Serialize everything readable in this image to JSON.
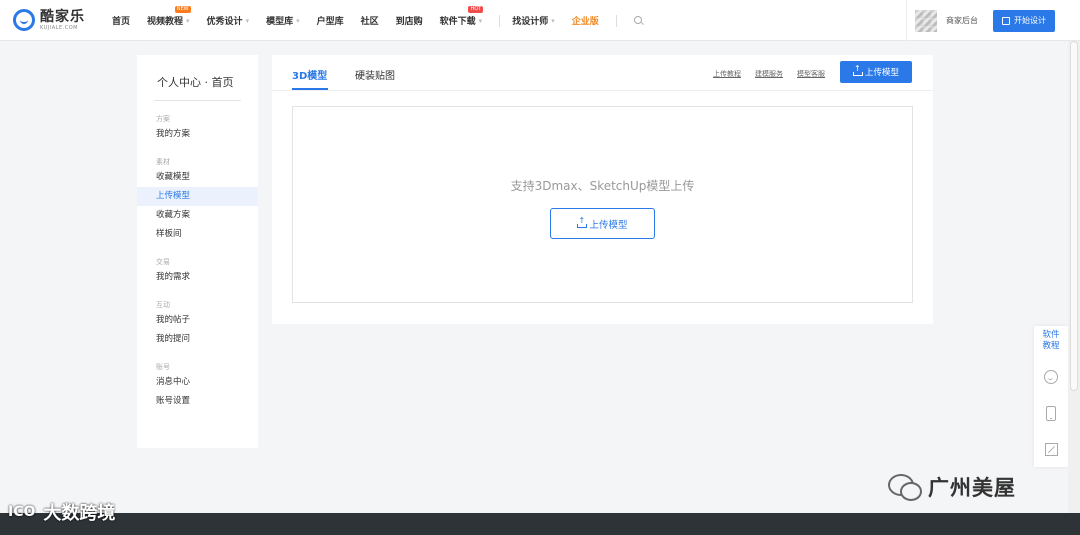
{
  "header": {
    "logo_cn": "酷家乐",
    "logo_en": "KUJIALE.COM",
    "nav": [
      {
        "label": "首页",
        "caret": false,
        "badge": ""
      },
      {
        "label": "视频教程",
        "caret": true,
        "badge": "NEW"
      },
      {
        "label": "优秀设计",
        "caret": true,
        "badge": ""
      },
      {
        "label": "模型库",
        "caret": true,
        "badge": ""
      },
      {
        "label": "户型库",
        "caret": false,
        "badge": ""
      },
      {
        "label": "社区",
        "caret": false,
        "badge": ""
      },
      {
        "label": "到店购",
        "caret": false,
        "badge": ""
      },
      {
        "label": "软件下载",
        "caret": true,
        "badge": "HOT"
      },
      {
        "label": "找设计师",
        "caret": true,
        "badge": ""
      },
      {
        "label": "企业版",
        "caret": false,
        "badge": ""
      }
    ],
    "merchant_label": "商家后台",
    "start_design_label": "开始设计"
  },
  "sidebar": {
    "title": "个人中心 · 首页",
    "groups": [
      {
        "title": "方案",
        "items": [
          {
            "label": "我的方案",
            "active": false
          }
        ]
      },
      {
        "title": "素材",
        "items": [
          {
            "label": "收藏模型",
            "active": false
          },
          {
            "label": "上传模型",
            "active": true
          },
          {
            "label": "收藏方案",
            "active": false
          },
          {
            "label": "样板间",
            "active": false
          }
        ]
      },
      {
        "title": "交易",
        "items": [
          {
            "label": "我的需求",
            "active": false
          }
        ]
      },
      {
        "title": "互动",
        "items": [
          {
            "label": "我的帖子",
            "active": false
          },
          {
            "label": "我的提问",
            "active": false
          }
        ]
      },
      {
        "title": "账号",
        "items": [
          {
            "label": "消息中心",
            "active": false
          },
          {
            "label": "账号设置",
            "active": false
          }
        ]
      }
    ]
  },
  "main": {
    "tabs": [
      {
        "label": "3D模型",
        "active": true
      },
      {
        "label": "硬装贴图",
        "active": false
      }
    ],
    "links": [
      "上传教程",
      "建模服务",
      "模型客服"
    ],
    "upload_button": "上传模型",
    "dropzone_text": "支持3Dmax、SketchUp模型上传",
    "dropzone_button": "上传模型"
  },
  "float_tools": {
    "tutorial_label": "软件\n教程",
    "icons": [
      "customer-service-icon",
      "mobile-icon",
      "feedback-edit-icon"
    ]
  },
  "watermarks": {
    "right": "广州美屋",
    "left_logo": "ICO",
    "left_text": "大数跨境"
  },
  "colors": {
    "accent": "#2b79e8",
    "enterprise": "#f08a24",
    "active_bg": "#ebf2fd"
  }
}
